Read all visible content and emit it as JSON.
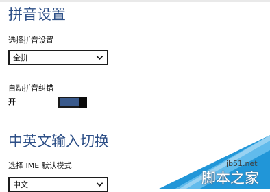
{
  "pinyin_section": {
    "title": "拼音设置",
    "setting_label": "选择拼音设置",
    "setting_value": "全拼",
    "autocorrect_label": "自动拼音纠错",
    "autocorrect_state": "开",
    "autocorrect_on": true
  },
  "cn_en_section": {
    "title": "中英文输入切换",
    "ime_mode_label": "选择 IME 默认模式",
    "ime_mode_value": "中文"
  },
  "watermark": {
    "domain": "jb51.net",
    "name": "脚本之家"
  },
  "colors": {
    "heading": "#2d4f87",
    "toggle_track": "#3a5a8c",
    "toggle_thumb": "#0a0a0a",
    "watermark_fold": "#2196d8"
  },
  "icons": {
    "dropdown": "chevron-down-icon"
  }
}
